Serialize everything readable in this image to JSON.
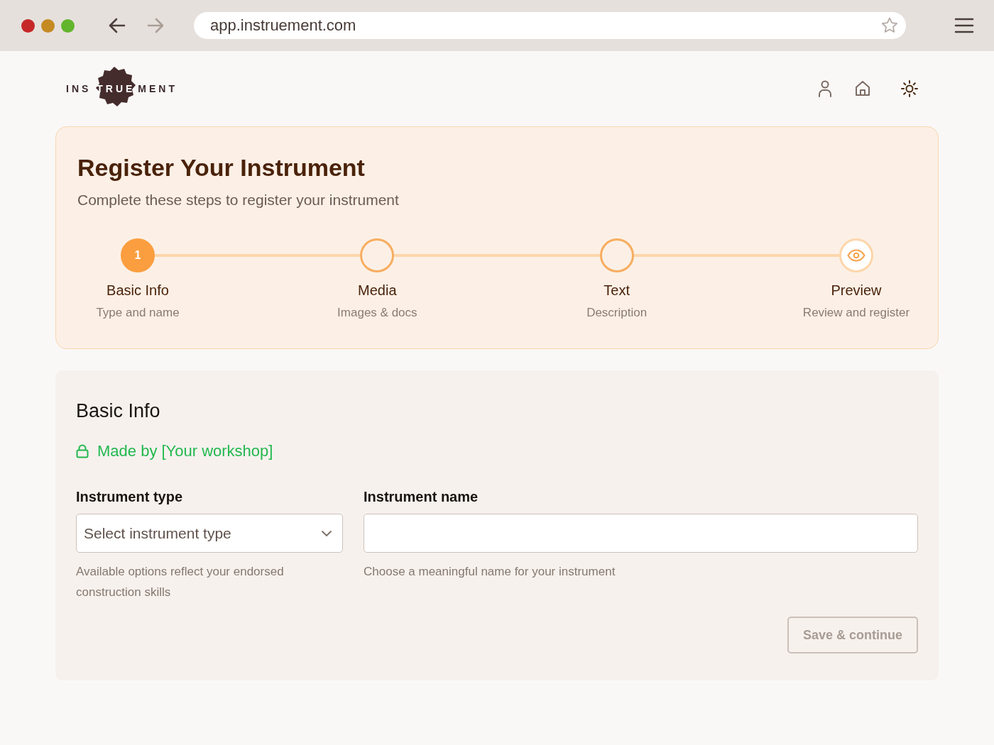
{
  "browser": {
    "url": "app.instruement.com"
  },
  "logo": {
    "before": "INS",
    "badge": "TRUE",
    "after": "MENT"
  },
  "hero": {
    "title": "Register Your Instrument",
    "subtitle": "Complete these steps to register your instrument",
    "steps": [
      {
        "kind": "number",
        "number": "1",
        "label": "Basic Info",
        "caption": "Type and name",
        "selected": true
      },
      {
        "kind": "empty",
        "label": "Media",
        "caption": "Images & docs",
        "selected": false
      },
      {
        "kind": "empty",
        "label": "Text",
        "caption": "Description",
        "selected": false
      },
      {
        "kind": "preview",
        "label": "Preview",
        "caption": "Review and register",
        "selected": false
      }
    ]
  },
  "form": {
    "title": "Basic Info",
    "maker": "Made by [Your workshop]",
    "fields": [
      {
        "kind": "select",
        "label": "Instrument type",
        "placeholder": "Select instrument type",
        "hint": "Available options reflect your endorsed construction skills"
      },
      {
        "kind": "text",
        "label": "Instrument name",
        "hint": "Choose a meaningful name for your instrument"
      }
    ],
    "button": {
      "label": "Save & continue",
      "disabled": true
    }
  }
}
